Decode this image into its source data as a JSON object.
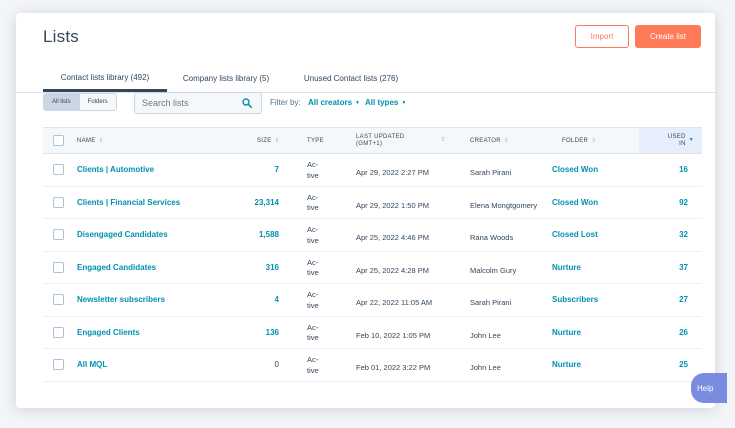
{
  "header": {
    "title": "Lists",
    "import_label": "Import",
    "create_label": "Create list"
  },
  "tabs": [
    {
      "label": "Contact lists library (492)"
    },
    {
      "label": "Company lists library (5)"
    },
    {
      "label": "Unused Contact lists (276)"
    }
  ],
  "filters": {
    "segment": [
      "All lists",
      "Folders"
    ],
    "search_placeholder": "Search lists",
    "filter_label": "Filter by:",
    "creators_label": "All creators",
    "types_label": "All types"
  },
  "table": {
    "headers": {
      "name": "NAME",
      "size": "SIZE",
      "type": "TYPE",
      "updated_line1": "LAST UPDATED",
      "updated_line2": "(GMT+1)",
      "creator": "CREATOR",
      "folder": "FOLDER",
      "used_line1": "USED",
      "used_line2": "IN"
    },
    "rows": [
      {
        "name": "Clients | Automotive",
        "size": "7",
        "type": "Ac- tive",
        "updated": "Apr 29, 2022 2:27 PM",
        "creator": "Sarah Pirani",
        "folder": "Closed Won",
        "used": "16"
      },
      {
        "name": "Clients | Financial Services",
        "size": "23,314",
        "type": "Ac- tive",
        "updated": "Apr 29, 2022 1:50 PM",
        "creator": "Elena Mongtgomery",
        "folder": "Closed Won",
        "used": "92"
      },
      {
        "name": "Disengaged  Candidates",
        "size": "1,588",
        "type": "Ac- tive",
        "updated": "Apr 25, 2022 4:46 PM",
        "creator": "Rana Woods",
        "folder": "Closed Lost",
        "used": "32"
      },
      {
        "name": "Engaged  Candidates",
        "size": "316",
        "type": "Ac- tive",
        "updated": "Apr 25, 2022 4:28 PM",
        "creator": "Malcolm Gury",
        "folder": "Nurture",
        "used": "37"
      },
      {
        "name": "Newsletter subscribers",
        "size": "4",
        "type": "Ac- tive",
        "updated": "Apr 22, 2022 11:05 AM",
        "creator": "Sarah Pirani",
        "folder": "Subscribers",
        "used": "27"
      },
      {
        "name": "Engaged Clients",
        "size": "136",
        "type": "Ac- tive",
        "updated": "Feb 10, 2022 1:05 PM",
        "creator": "John Lee",
        "folder": "Nurture",
        "used": "26"
      },
      {
        "name": "All MQL",
        "size": "0",
        "type": "Ac- tive",
        "updated": "Feb 01, 2022 3:22 PM",
        "creator": "John Lee",
        "folder": "Nurture",
        "used": "25"
      }
    ]
  },
  "help_label": "Help",
  "colors": {
    "accent": "#ff7a59",
    "link": "#0091ae",
    "text": "#33475b",
    "help": "#7a8cdf"
  }
}
